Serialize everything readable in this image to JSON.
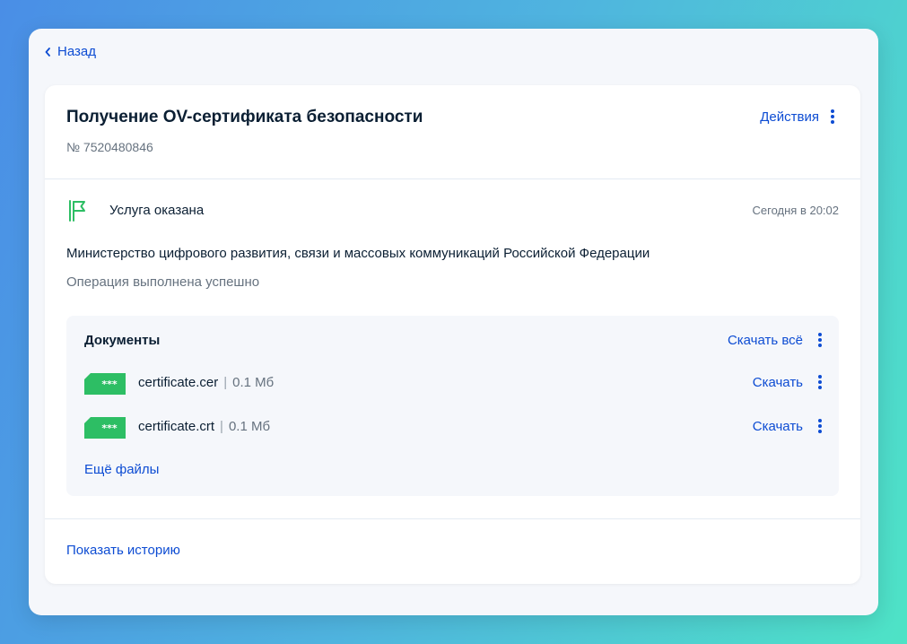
{
  "nav": {
    "back_label": "Назад"
  },
  "card": {
    "title": "Получение OV-сертификата безопасности",
    "number": "№ 7520480846",
    "actions_label": "Действия"
  },
  "status": {
    "text": "Услуга оказана",
    "time": "Сегодня в 20:02",
    "icon": "flag-icon"
  },
  "ministry": "Министерство цифрового развития, связи и массовых коммуникаций Российской Федерации",
  "operation_result": "Операция выполнена успешно",
  "documents": {
    "title": "Документы",
    "download_all_label": "Скачать всё",
    "files": [
      {
        "badge": "***",
        "name": "certificate.cer",
        "separator": "|",
        "size": "0.1 Мб",
        "download_label": "Скачать"
      },
      {
        "badge": "***",
        "name": "certificate.crt",
        "separator": "|",
        "size": "0.1 Мб",
        "download_label": "Скачать"
      }
    ],
    "more_files_label": "Ещё файлы"
  },
  "history_label": "Показать историю",
  "colors": {
    "accent": "#0d4cd3",
    "badge_green": "#2dbe64",
    "text_primary": "#0b1f33",
    "text_secondary": "#66727f"
  }
}
